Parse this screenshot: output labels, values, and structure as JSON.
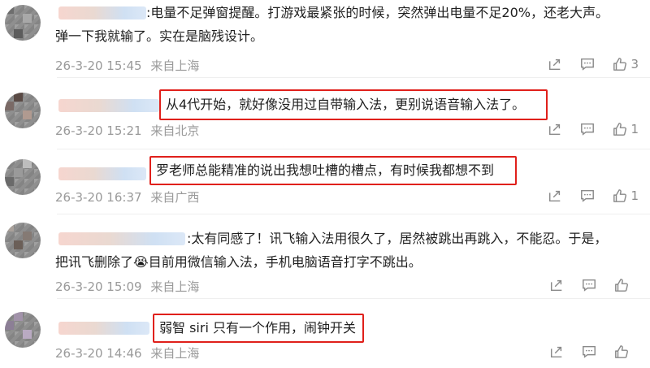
{
  "comments": [
    {
      "text_lines": [
        ":电量不足弹窗提醒。打游戏最紧张的时候，突然弹出电量不足20%，还老大声。",
        "弹一下我就输了。实在是脑残设计。"
      ],
      "date": "26-3-20 15:45",
      "location": "来自上海",
      "like_count": "3",
      "highlighted": false
    },
    {
      "text_lines": [
        "从4代开始，就好像没用过自带输入法，更别说语音输入法了。"
      ],
      "date": "26-3-20 15:21",
      "location": "来自北京",
      "like_count": "1",
      "highlighted": true
    },
    {
      "text_lines": [
        "罗老师总能精准的说出我想吐槽的槽点，有时候我都想不到"
      ],
      "date": "26-3-20 16:37",
      "location": "来自广西",
      "like_count": "1",
      "highlighted": true
    },
    {
      "text_lines": [
        ":太有同感了！讯飞输入法用很久了，居然被跳出再跳入，不能忍。于是，",
        "把讯飞删除了😭目前用微信输入法，手机电脑语音打字不跳出。"
      ],
      "date": "26-3-20 15:09",
      "location": "来自上海",
      "like_count": "",
      "highlighted": false
    },
    {
      "text_lines": [
        "弱智 siri 只有一个作用，闹钟开关"
      ],
      "date": "26-3-20 14:46",
      "location": "来自上海",
      "like_count": "",
      "highlighted": true
    }
  ],
  "icons": {
    "share": "share-icon",
    "comment": "comment-icon",
    "like": "thumbs-up-icon"
  },
  "colors": {
    "highlight_border": "#e0201b",
    "meta_text": "#9a9a9a",
    "icon": "#8a8a8a"
  }
}
